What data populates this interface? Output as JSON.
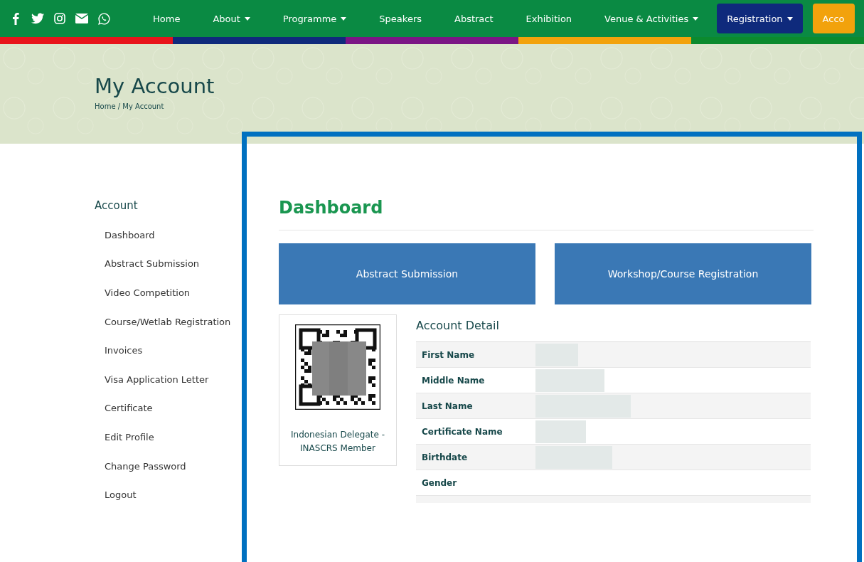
{
  "nav": {
    "social": [
      {
        "kind": "facebook"
      },
      {
        "kind": "twitter"
      },
      {
        "kind": "instagram"
      },
      {
        "kind": "mail"
      },
      {
        "kind": "whatsapp"
      }
    ],
    "items": [
      {
        "label": "Home",
        "dropdown": false,
        "kind": "link"
      },
      {
        "label": "About",
        "dropdown": true,
        "kind": "link"
      },
      {
        "label": "Programme",
        "dropdown": true,
        "kind": "link"
      },
      {
        "label": "Speakers",
        "dropdown": false,
        "kind": "link"
      },
      {
        "label": "Abstract",
        "dropdown": false,
        "kind": "link"
      },
      {
        "label": "Exhibition",
        "dropdown": false,
        "kind": "link"
      },
      {
        "label": "Venue & Activities",
        "dropdown": true,
        "kind": "link"
      },
      {
        "label": "Registration",
        "dropdown": true,
        "kind": "registration"
      },
      {
        "label": "Acco",
        "dropdown": false,
        "kind": "account"
      }
    ]
  },
  "hero": {
    "title": "My Account",
    "breadcrumb": "Home / My Account"
  },
  "sidebar": {
    "heading": "Account",
    "items": [
      "Dashboard",
      "Abstract Submission",
      "Video Competition",
      "Course/Wetlab Registration",
      "Invoices",
      "Visa Application Letter",
      "Certificate",
      "Edit Profile",
      "Change Password",
      "Logout"
    ]
  },
  "main": {
    "title": "Dashboard",
    "buttons": [
      "Abstract Submission",
      "Workshop/Course Registration"
    ],
    "card": {
      "caption": "Indonesian Delegate - INASCRS Member"
    },
    "detail": {
      "heading": "Account Detail",
      "rows": [
        {
          "label": "First Name",
          "blurred": true
        },
        {
          "label": "Middle Name",
          "blurred": true
        },
        {
          "label": "Last Name",
          "blurred": true
        },
        {
          "label": "Certificate Name",
          "blurred": true
        },
        {
          "label": "Birthdate",
          "blurred": true
        },
        {
          "label": "Gender",
          "blurred": false
        }
      ]
    }
  }
}
